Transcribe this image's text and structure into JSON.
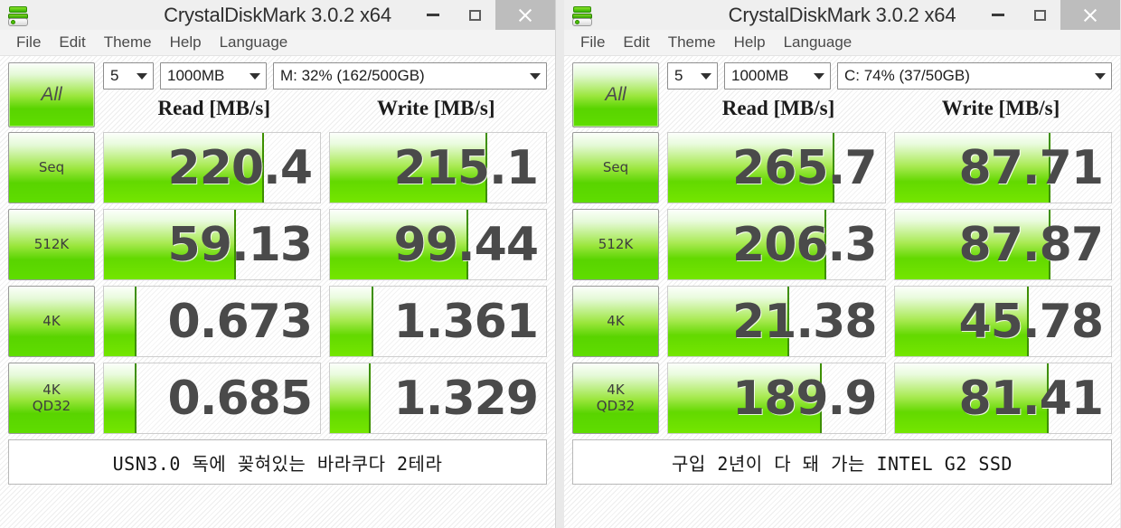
{
  "windows": [
    {
      "title": "CrystalDiskMark 3.0.2 x64",
      "icon": "disk-drive-icon",
      "menu": [
        "File",
        "Edit",
        "Theme",
        "Help",
        "Language"
      ],
      "controls": {
        "all_button": "All",
        "run_count": "5",
        "test_size": "1000MB",
        "drive": "M: 32% (162/500GB)"
      },
      "column_headers": [
        "Read [MB/s]",
        "Write [MB/s]"
      ],
      "rows": [
        {
          "label_line1": "Seq",
          "label_line2": "",
          "read": "220.4",
          "write": "215.1",
          "read_fill_pct": 74,
          "write_fill_pct": 73
        },
        {
          "label_line1": "512K",
          "label_line2": "",
          "read": "59.13",
          "write": "99.44",
          "read_fill_pct": 61,
          "write_fill_pct": 64
        },
        {
          "label_line1": "4K",
          "label_line2": "",
          "read": "0.673",
          "write": "1.361",
          "read_fill_pct": 15,
          "write_fill_pct": 20
        },
        {
          "label_line1": "4K",
          "label_line2": "QD32",
          "read": "0.685",
          "write": "1.329",
          "read_fill_pct": 15,
          "write_fill_pct": 19
        }
      ],
      "comment": "USN3.0 독에 꽂혀있는 바라쿠다 2테라",
      "window_buttons": {
        "minimize": "minimize-button",
        "maximize": "maximize-button",
        "close": "close-button"
      }
    },
    {
      "title": "CrystalDiskMark 3.0.2 x64",
      "icon": "disk-drive-icon",
      "menu": [
        "File",
        "Edit",
        "Theme",
        "Help",
        "Language"
      ],
      "controls": {
        "all_button": "All",
        "run_count": "5",
        "test_size": "1000MB",
        "drive": "C: 74% (37/50GB)"
      },
      "column_headers": [
        "Read [MB/s]",
        "Write [MB/s]"
      ],
      "rows": [
        {
          "label_line1": "Seq",
          "label_line2": "",
          "read": "265.7",
          "write": "87.71",
          "read_fill_pct": 77,
          "write_fill_pct": 72
        },
        {
          "label_line1": "512K",
          "label_line2": "",
          "read": "206.3",
          "write": "87.87",
          "read_fill_pct": 73,
          "write_fill_pct": 72
        },
        {
          "label_line1": "4K",
          "label_line2": "",
          "read": "21.38",
          "write": "45.78",
          "read_fill_pct": 56,
          "write_fill_pct": 62
        },
        {
          "label_line1": "4K",
          "label_line2": "QD32",
          "read": "189.9",
          "write": "81.41",
          "read_fill_pct": 71,
          "write_fill_pct": 71
        }
      ],
      "comment": "구입 2년이 다 돼 가는 INTEL G2 SSD",
      "window_buttons": {
        "minimize": "minimize-button",
        "maximize": "maximize-button",
        "close": "close-button"
      }
    }
  ],
  "colors": {
    "accent_green": "#5fdd00",
    "fill_edge": "#3d8f00",
    "value_text": "#4a4a4a",
    "titlebar_bg": "#efefef",
    "close_hover_bg": "#bdbdbd"
  }
}
